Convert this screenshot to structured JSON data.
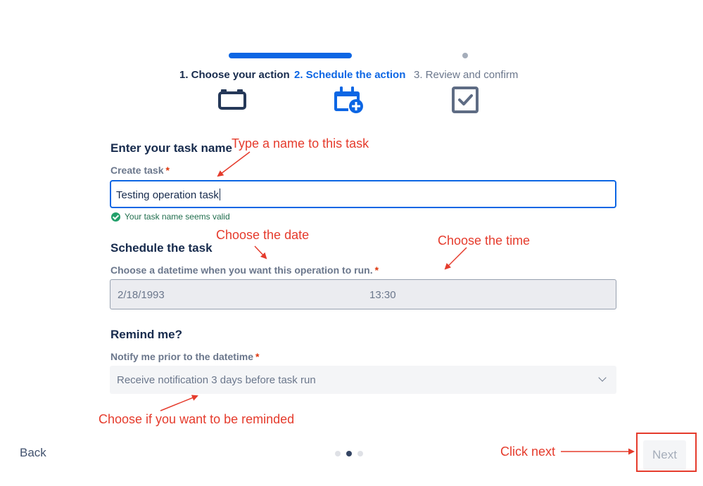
{
  "wizard": {
    "steps": [
      {
        "label": "1. Choose your action"
      },
      {
        "label": "2. Schedule the action"
      },
      {
        "label": "3. Review and confirm"
      }
    ]
  },
  "form": {
    "task_section_title": "Enter your task name",
    "task_label": "Create task",
    "task_value": "Testing operation task",
    "valid_message": "Your task name seems valid",
    "schedule_section_title": "Schedule the task",
    "datetime_label": "Choose a datetime when you want this operation to run.",
    "date_value": "2/18/1993",
    "time_value": "13:30",
    "remind_section_title": "Remind me?",
    "notify_label": "Notify me prior to the datetime",
    "notify_value": "Receive notification 3 days before task run",
    "required_mark": "*"
  },
  "footer": {
    "back_label": "Back",
    "next_label": "Next",
    "page_indicator": {
      "count": 3,
      "active": 2
    }
  },
  "annotations": {
    "type_name": "Type a name to this task",
    "choose_date": "Choose the date",
    "choose_time": "Choose the time",
    "choose_remind": "Choose if you want to be reminded",
    "click_next": "Click next"
  },
  "colors": {
    "accent": "#0c66e4",
    "annotation": "#e53b2c",
    "valid": "#22a06b"
  }
}
